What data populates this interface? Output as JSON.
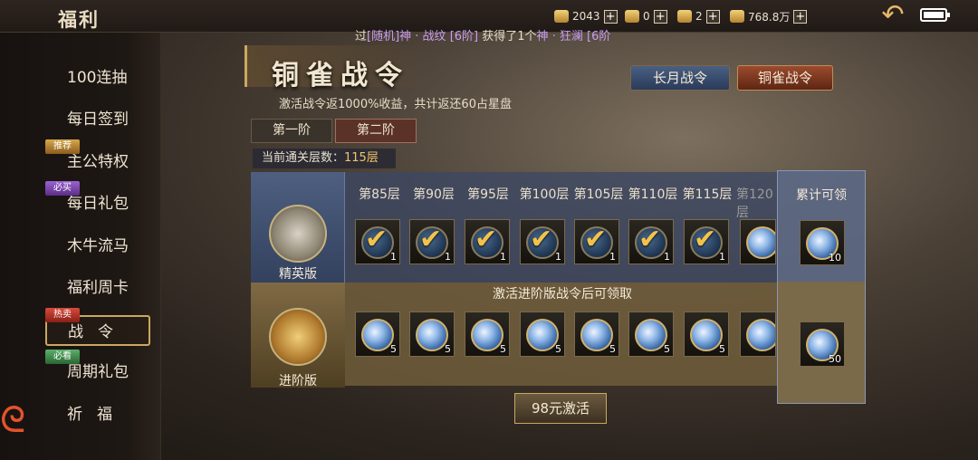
{
  "header": {
    "title": "福利",
    "resources": [
      {
        "icon": "ingot-icon",
        "value": "2043"
      },
      {
        "icon": "coin-pile-icon",
        "value": "0"
      },
      {
        "icon": "scroll-icon",
        "value": "2"
      },
      {
        "icon": "gold-coin-icon",
        "value": "768.8万"
      }
    ],
    "plus": "+",
    "ticker": {
      "pre": "过",
      "hl1": "[随机]神 · 战纹 [6阶]",
      "mid": " 获得了1个",
      "hl2": "神 · 狂澜 [6阶"
    }
  },
  "sidebar": {
    "items": [
      {
        "label": "100连抽"
      },
      {
        "label": "每日签到"
      },
      {
        "label": "主公特权",
        "badge": "推荐"
      },
      {
        "label": "每日礼包",
        "badge": "必买"
      },
      {
        "label": "木牛流马"
      },
      {
        "label": "福利周卡"
      },
      {
        "label": "战令",
        "badge": "热卖"
      },
      {
        "label": "周期礼包",
        "badge": "必看"
      },
      {
        "label": "祈福"
      }
    ]
  },
  "main": {
    "title": "铜雀战令",
    "subtitle": "激活战令返1000%收益，共计返还60占星盘",
    "tabs": {
      "tab1": "长月战令",
      "tab2": "铜雀战令"
    },
    "tiers": {
      "t1": "第一阶",
      "t2": "第二阶"
    },
    "floor_label": "当前通关层数：",
    "floor_value": "115层",
    "floors": [
      "第85层",
      "第90层",
      "第95层",
      "第100层",
      "第105层",
      "第110层",
      "第115层",
      "第120层"
    ],
    "elite_label": "精英版",
    "advanced_label": "进阶版",
    "elite_counts": [
      "1",
      "1",
      "1",
      "1",
      "1",
      "1",
      "1",
      ""
    ],
    "advanced_note": "激活进阶版战令后可领取",
    "advanced_counts": [
      "5",
      "5",
      "5",
      "5",
      "5",
      "5",
      "5",
      ""
    ],
    "cumulative_title": "累计可领",
    "cumulative_elite": "10",
    "cumulative_advanced": "50",
    "activate_button": "98元激活"
  }
}
